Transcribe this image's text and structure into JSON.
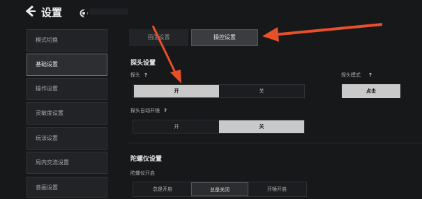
{
  "header": {
    "title": "设置"
  },
  "sidebar": {
    "items": [
      {
        "label": "模式切换"
      },
      {
        "label": "基础设置"
      },
      {
        "label": "操作设置"
      },
      {
        "label": "灵敏度设置"
      },
      {
        "label": "玩法设置"
      },
      {
        "label": "局内交流设置"
      },
      {
        "label": "音画设置"
      }
    ],
    "active_index": 1
  },
  "tabs": [
    {
      "label": "画面设置"
    },
    {
      "label": "操控设置"
    }
  ],
  "sections": {
    "camera": {
      "title": "探头设置",
      "probe": {
        "label": "探头",
        "help": "?",
        "options": [
          "开",
          "关"
        ],
        "selected": "开"
      },
      "probe_mode": {
        "label": "探头模式",
        "help": "?",
        "options": [
          "点击"
        ],
        "selected": "点击"
      },
      "auto_probe": {
        "label": "探头自动开镜",
        "help": "?",
        "options": [
          "开",
          "关"
        ],
        "selected": "关"
      }
    },
    "gyro": {
      "title": "陀螺仪设置",
      "gyro_enable": {
        "label": "陀螺仪开启",
        "options": [
          "总是开启",
          "总是关闭",
          "开镜开启"
        ],
        "selected": "总是关闭"
      }
    }
  },
  "colors": {
    "arrow": "#e8502a",
    "bg": "#17181a",
    "selected": "#c9c9c9"
  }
}
